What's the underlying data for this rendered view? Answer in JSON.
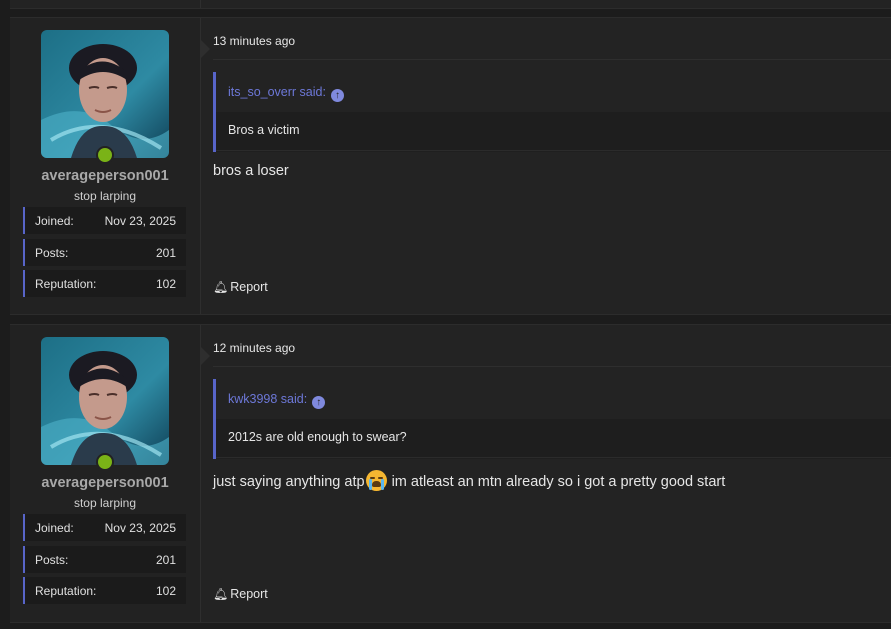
{
  "posts": [
    {
      "user": {
        "name": "averageperson001",
        "title": "stop larping",
        "online": true,
        "stats": [
          {
            "label": "Joined:",
            "value": "Nov 23, 2025"
          },
          {
            "label": "Posts:",
            "value": "201"
          },
          {
            "label": "Reputation:",
            "value": "102"
          }
        ]
      },
      "time": "13 minutes ago",
      "quote": {
        "author": "its_so_overr said:",
        "text": "Bros a victim"
      },
      "body": "bros a loser",
      "report_label": "Report"
    },
    {
      "user": {
        "name": "averageperson001",
        "title": "stop larping",
        "online": true,
        "stats": [
          {
            "label": "Joined:",
            "value": "Nov 23, 2025"
          },
          {
            "label": "Posts:",
            "value": "201"
          },
          {
            "label": "Reputation:",
            "value": "102"
          }
        ]
      },
      "time": "12 minutes ago",
      "quote": {
        "author": "kwk3998 said:",
        "text": "2012s are old enough to swear?"
      },
      "body_before_emoji": "just saying anything atp",
      "body_emoji": "loudly-crying-face-emoji",
      "body_after_emoji": " im atleast an mtn already so i got a pretty good start",
      "report_label": "Report"
    }
  ],
  "colors": {
    "accent": "#5865c9",
    "online": "#7ab317",
    "background": "#1c1c1c",
    "panel": "#232323"
  },
  "icons": {
    "quote_jump": "arrow-up-circle-icon",
    "report": "bell-icon"
  }
}
